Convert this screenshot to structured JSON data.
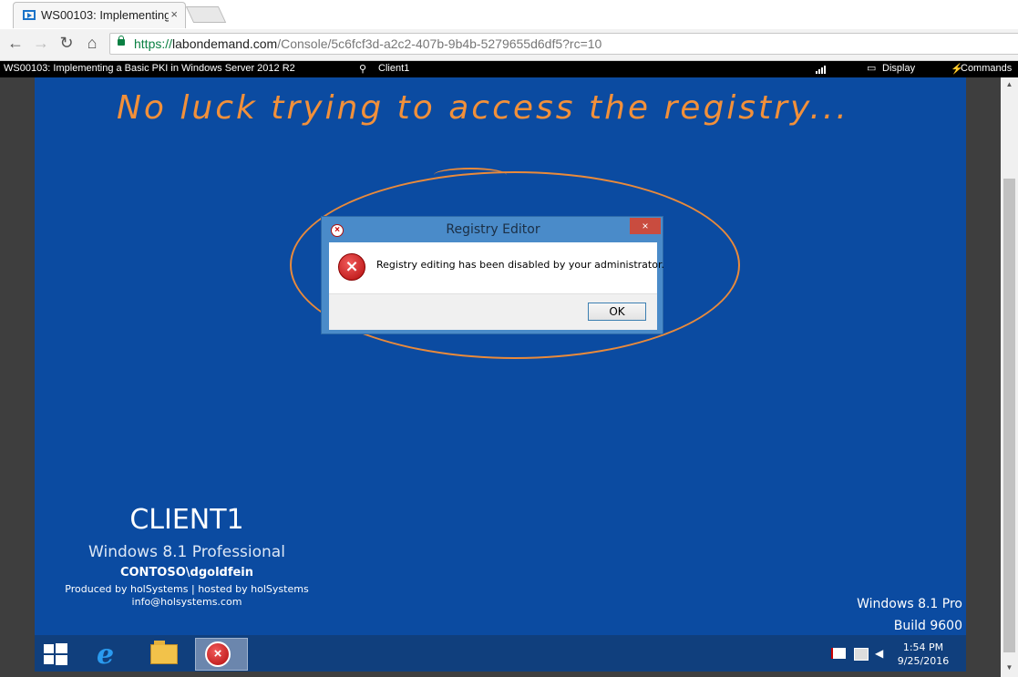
{
  "browser": {
    "tab_title": "WS00103: Implementing",
    "tab_close": "×",
    "url_scheme": "https://",
    "url_host": "labondemand.com",
    "url_path": "/Console/5c6fcf3d-a2c2-407b-9b4b-5279655d6df5?rc=10",
    "nav": {
      "back": "←",
      "forward": "→",
      "reload": "↻",
      "home": "⌂"
    }
  },
  "lod_toolbar": {
    "lab_title": "WS00103: Implementing a Basic PKI in Windows Server 2012 R2",
    "pin_icon": "⚲",
    "machine": "Client1",
    "display_label": "Display",
    "commands_label": "Commands",
    "commands_icon": "⚡"
  },
  "annotation": {
    "handwritten_text": "No luck trying to access the registry..."
  },
  "dialog": {
    "title": "Registry Editor",
    "close": "×",
    "message": "Registry editing has been disabled by your administrator.",
    "ok_label": "OK",
    "error_glyph": "×"
  },
  "desktop": {
    "hostname": "CLIENT1",
    "os": "Windows 8.1 Professional",
    "user": "CONTOSO\\dgoldfein",
    "produced_by": "Produced by holSystems | hosted by holSystems",
    "email": "info@holsystems.com",
    "watermark_line1": "Windows 8.1 Pro",
    "watermark_line2": "Build 9600"
  },
  "taskbar": {
    "ie_glyph": "e",
    "time": "1:54 PM",
    "date": "9/25/2016"
  },
  "colors": {
    "desktop_blue": "#0b4ba1",
    "annotation_orange": "#f2903a",
    "dialog_frame": "#4a8bc9"
  }
}
